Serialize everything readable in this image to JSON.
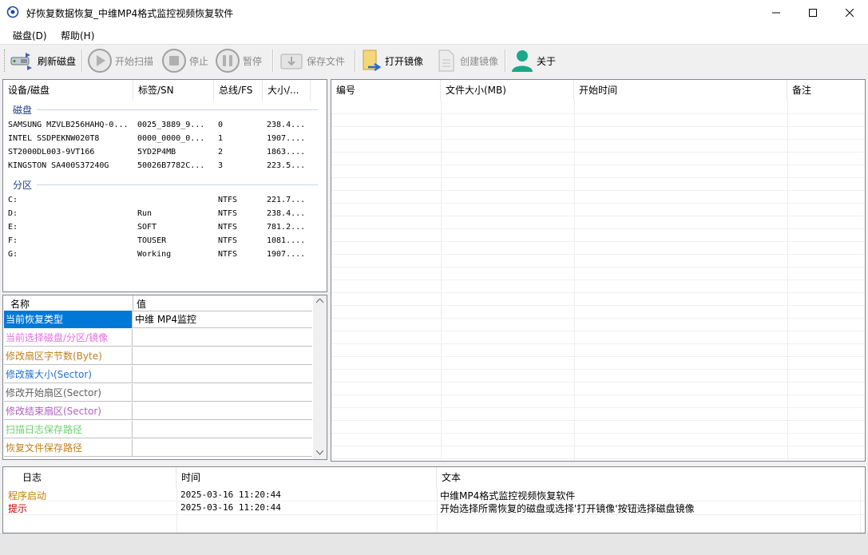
{
  "window": {
    "title": "好恢复数据恢复_中维MP4格式监控视频恢复软件"
  },
  "menu": [
    "磁盘(D)",
    "帮助(H)"
  ],
  "toolbar": {
    "refresh": "刷新磁盘",
    "start_scan": "开始扫描",
    "stop": "停止",
    "pause": "暂停",
    "save_file": "保存文件",
    "open_image": "打开镜像",
    "create_image": "创建镜像",
    "about": "关于"
  },
  "device_list": {
    "columns": [
      "设备/磁盘",
      "标签/SN",
      "总线/FS",
      "大小/..."
    ],
    "disk_group": "磁盘",
    "disks": [
      {
        "name": "SAMSUNG MZVLB256HAHQ-0...",
        "sn": "0025_3889_9...",
        "bus": "0",
        "size": "238.4..."
      },
      {
        "name": "INTEL SSDPEKNW020T8",
        "sn": "0000_0000_0...",
        "bus": "1",
        "size": "1907...."
      },
      {
        "name": "ST2000DL003-9VT166",
        "sn": "5YD2P4MB",
        "bus": "2",
        "size": "1863...."
      },
      {
        "name": "KINGSTON SA400S37240G",
        "sn": "50026B7782C...",
        "bus": "3",
        "size": "223.5..."
      }
    ],
    "partition_group": "分区",
    "partitions": [
      {
        "name": "C:",
        "label": "",
        "fs": "NTFS",
        "size": "221.7..."
      },
      {
        "name": "D:",
        "label": "Run",
        "fs": "NTFS",
        "size": "238.4..."
      },
      {
        "name": "E:",
        "label": "SOFT",
        "fs": "NTFS",
        "size": "781.2..."
      },
      {
        "name": "F:",
        "label": "TOUSER",
        "fs": "NTFS",
        "size": "1081...."
      },
      {
        "name": "G:",
        "label": "Working",
        "fs": "NTFS",
        "size": "1907...."
      }
    ]
  },
  "properties": {
    "columns": [
      "名称",
      "值"
    ],
    "rows": [
      {
        "name": "当前恢复类型",
        "value": "中维 MP4监控",
        "color": "#ffffff",
        "selected": true
      },
      {
        "name": "当前选择磁盘/分区/镜像",
        "value": "",
        "color": "#e070e0"
      },
      {
        "name": "修改扇区字节数(Byte)",
        "value": "",
        "color": "#c08020"
      },
      {
        "name": "修改簇大小(Sector)",
        "value": "",
        "color": "#2070d0"
      },
      {
        "name": "修改开始扇区(Sector)",
        "value": "",
        "color": "#606060"
      },
      {
        "name": "修改结束扇区(Sector)",
        "value": "",
        "color": "#b060c0"
      },
      {
        "name": "扫描日志保存路径",
        "value": "",
        "color": "#70d070"
      },
      {
        "name": "恢复文件保存路径",
        "value": "",
        "color": "#c08020"
      }
    ]
  },
  "file_list": {
    "columns": [
      "编号",
      "文件大小(MB)",
      "开始时间",
      "备注"
    ]
  },
  "log": {
    "columns": [
      "日志",
      "时间",
      "文本"
    ],
    "rows": [
      {
        "type": "程序启动",
        "time": "2025-03-16 11:20:44",
        "text": "中维MP4格式监控视频恢复软件",
        "color": "#c08000"
      },
      {
        "type": "提示",
        "time": "2025-03-16 11:20:44",
        "text": "开始选择所需恢复的磁盘或选择'打开镜像'按钮选择磁盘镜像",
        "color": "#c00000"
      }
    ]
  }
}
